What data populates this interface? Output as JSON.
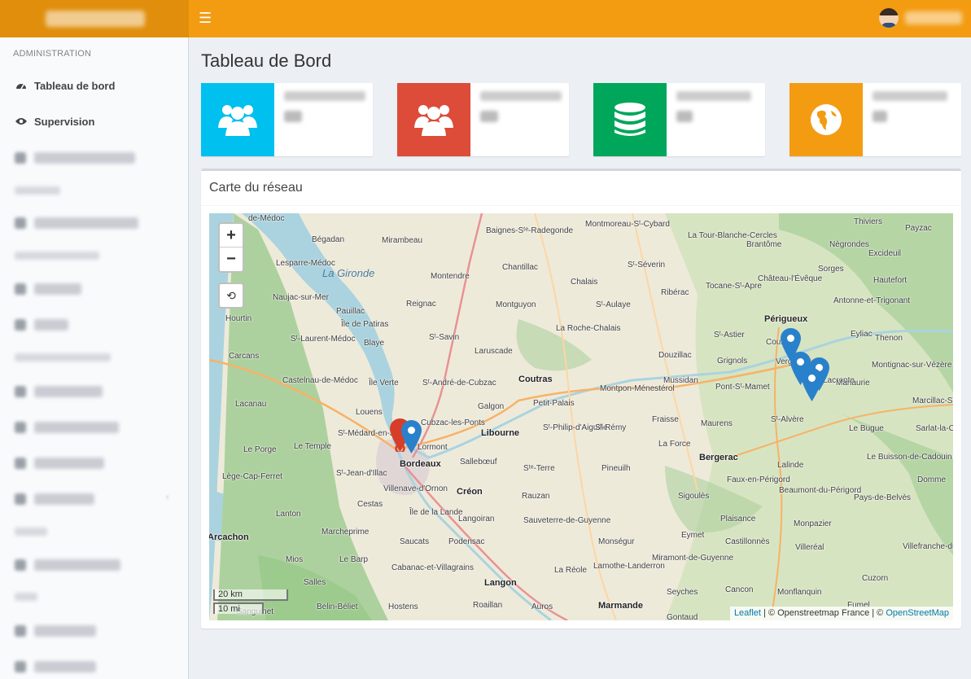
{
  "header": {
    "menu_icon": "hamburger-icon"
  },
  "sidebar": {
    "section_admin": "ADMINISTRATION",
    "items": [
      {
        "label": "Tableau de bord",
        "icon": "dashboard-icon"
      },
      {
        "label": "Supervision",
        "icon": "eye-icon"
      }
    ]
  },
  "page": {
    "title": "Tableau de Bord"
  },
  "info_boxes": [
    {
      "icon": "users-icon",
      "color": "#00c0ef"
    },
    {
      "icon": "users-icon",
      "color": "#dd4b39"
    },
    {
      "icon": "database-icon",
      "color": "#00a65a"
    },
    {
      "icon": "globe-icon",
      "color": "#f39c12"
    }
  ],
  "map_box": {
    "title": "Carte du réseau",
    "zoom_in": "+",
    "zoom_out": "−",
    "reset": "⟲",
    "scale_km": "20 km",
    "scale_mi": "10 mi",
    "attribution": {
      "leaflet": "Leaflet",
      "sep1": " | © Openstreetmap France | © ",
      "osm": "OpenStreetMap"
    },
    "places": [
      "de-Médoc",
      "Bégadan",
      "Mirambeau",
      "Baignes-Sᵗᵉ-Radegonde",
      "Montmoreau-Sᵗ-Cybard",
      "La Tour-Blanche-Cercles",
      "Brantôme",
      "Thiviers",
      "Payzac",
      "Lesparre-Médoc",
      "La Gironde",
      "Montendre",
      "Chantillac",
      "Chalais",
      "Sᵗ-Séverin",
      "Nègrondes",
      "Excideuil",
      "Naujac-sur-Mer",
      "Reignac",
      "Montguyon",
      "Ribérac",
      "Tocane-Sᵗ-Apre",
      "Château-l'Évêque",
      "Sorges",
      "Hautefort",
      "Pauillac",
      "Île de Patiras",
      "Sᵗ-Aulaye",
      "Antonne-et-Trigonant",
      "Hourtin",
      "Blaye",
      "Sᵗ-Savin",
      "Laruscade",
      "La Roche-Chalais",
      "Périgueux",
      "Sᵗ-Astier",
      "Eyliac",
      "Thenon",
      "Sᵗ-Laurent-Médoc",
      "Douzillac",
      "Grignols",
      "Coursac",
      "Montignac-sur-Vézère",
      "Carcans",
      "Île Verte",
      "Sᵗ-André-de-Cubzac",
      "Coutras",
      "Mussidan",
      "Vergt",
      "Lacropte",
      "Castelnau-de-Médoc",
      "Petit-Palais",
      "Montpon-Ménestérol",
      "Pont-Sᵗ-Mamet",
      "Manaurie",
      "Marcillac-Sᵗ-Quentin",
      "Lacanau",
      "Louens",
      "Galgon",
      "Sᵗ-Alvère",
      "Sᵗ-Médard-en-Jalles",
      "Cubzac-les-Ponts",
      "Libourne",
      "Sᵗ-Philip-d'Aiguille",
      "Sᵗ-Rémy",
      "Fraisse",
      "Maurens",
      "Le Bugue",
      "Sarlat-la-Canéda",
      "Le Temple",
      "Le Porge",
      "Bordeaux",
      "Lormont",
      "Sallebœuf",
      "La Force",
      "Bergerac",
      "Lalinde",
      "Le Buisson-de-Cadouin",
      "Lège-Cap-Ferret",
      "Sᵗ-Jean-d'Illac",
      "Sᵗᵉ-Terre",
      "Pineuilh",
      "Faux-en-Périgord",
      "Beaumont-du-Périgord",
      "Domme",
      "Villenave-d'Ornon",
      "Créon",
      "Rauzan",
      "Sigoulès",
      "Cestas",
      "Pays-de-Belvès",
      "Lanton",
      "Île de la Lande",
      "Langoiran",
      "Sauveterre-de-Guyenne",
      "Plaisance",
      "Monpazier",
      "Arcachon",
      "Marcheprime",
      "Saucats",
      "Podensac",
      "Monségur",
      "Eymet",
      "Castillonnès",
      "Villefranche-du-Périgord",
      "Villeréal",
      "Mios",
      "Le Barp",
      "Cabanac-et-Villagrains",
      "Miramont-de-Guyenne",
      "Salles",
      "La Réole",
      "Lamothe-Landerron",
      "Langon",
      "Cuzorn",
      "Belin-Béliet",
      "Hostens",
      "Roaillan",
      "Auros",
      "Marmande",
      "Seyches",
      "Cancon",
      "Monflanquin",
      "Sanguinet",
      "Gontaud",
      "Fumel"
    ]
  }
}
